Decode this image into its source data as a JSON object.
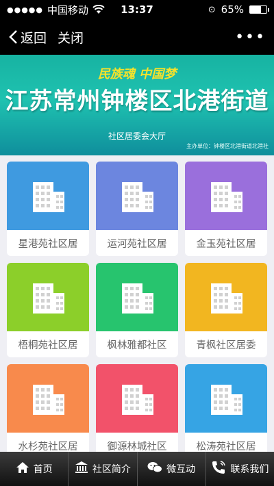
{
  "status": {
    "carrier": "中国移动",
    "time": "13:37",
    "battery": "65%",
    "battery_level": 0.65
  },
  "nav": {
    "back_label": "返回",
    "close_label": "关闭",
    "more_icon": "ellipsis-icon"
  },
  "banner": {
    "slogan": "民族魂 中国梦",
    "title": "江苏常州钟楼区北港街道",
    "subtitle": "社区居委会大厅",
    "organizer": "主办单位：钟楼区北港街道北港社"
  },
  "tiles": [
    {
      "label": "星港苑社区居",
      "color": "#3f9ae0",
      "icon": "building-icon"
    },
    {
      "label": "运河苑社区居",
      "color": "#6c86df",
      "icon": "building-icon"
    },
    {
      "label": "金玉苑社区居",
      "color": "#9a6fdc",
      "icon": "building-icon"
    },
    {
      "label": "梧桐苑社区居",
      "color": "#8ccf2a",
      "icon": "building-icon"
    },
    {
      "label": "枫林雅都社区",
      "color": "#27c46e",
      "icon": "building-icon"
    },
    {
      "label": "青枫社区居委",
      "color": "#f2b620",
      "icon": "building-icon"
    },
    {
      "label": "水杉苑社区居",
      "color": "#f88a4c",
      "icon": "building-icon"
    },
    {
      "label": "御源林城社区",
      "color": "#f2526a",
      "icon": "building-icon"
    },
    {
      "label": "松涛苑社区居",
      "color": "#36a4e4",
      "icon": "building-icon"
    }
  ],
  "tabbar": [
    {
      "label": "首页",
      "icon": "home-icon"
    },
    {
      "label": "社区简介",
      "icon": "bank-icon"
    },
    {
      "label": "微互动",
      "icon": "wechat-icon"
    },
    {
      "label": "联系我们",
      "icon": "phone-icon"
    }
  ]
}
